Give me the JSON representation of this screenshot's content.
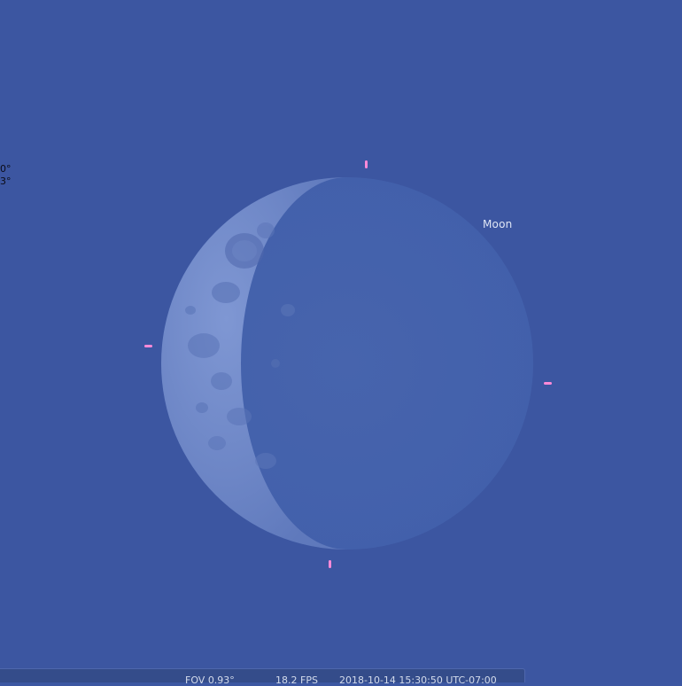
{
  "colors": {
    "sky": "#3c56a1",
    "marker": "#ff8ad8",
    "label": "#dfe6f5",
    "status_text": "#d3dbec"
  },
  "object": {
    "name": "Moon"
  },
  "coordinates": {
    "line1": "0°",
    "line2": "3°"
  },
  "icons": {
    "selection_marker": "pink-tick-marker"
  },
  "status_bar": {
    "fov": "FOV 0.93°",
    "fps": "18.2 FPS",
    "datetime": "2018-10-14 15:30:50 UTC-07:00"
  }
}
